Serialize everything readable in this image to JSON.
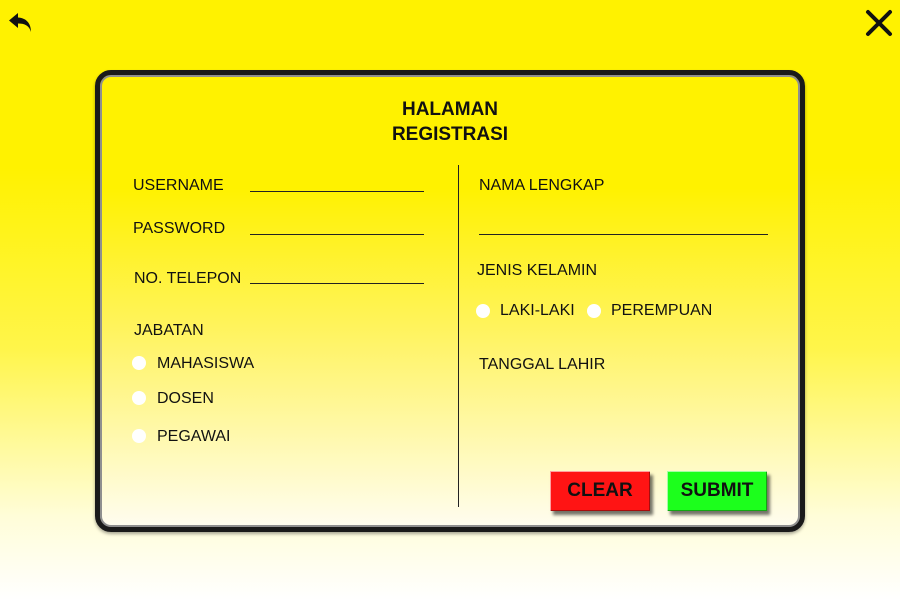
{
  "nav": {
    "back_icon": "undo-arrow-icon",
    "close_icon": "close-x-icon"
  },
  "form": {
    "title_line1": "HALAMAN",
    "title_line2": "REGISTRASI",
    "username_label": "USERNAME",
    "password_label": "PASSWORD",
    "phone_label": "NO. TELEPON",
    "position_label": "JABATAN",
    "position_options": [
      "MAHASISWA",
      "DOSEN",
      "PEGAWAI"
    ],
    "fullname_label": "NAMA LENGKAP",
    "gender_label": "JENIS KELAMIN",
    "gender_options": [
      "LAKI-LAKI",
      "PEREMPUAN"
    ],
    "birthdate_label": "TANGGAL LAHIR",
    "username_value": "",
    "password_value": "",
    "phone_value": "",
    "fullname_value": ""
  },
  "buttons": {
    "clear": "CLEAR",
    "submit": "SUBMIT"
  },
  "colors": {
    "background": "#fff200",
    "clear_button": "#ff1414",
    "submit_button": "#1cff1c",
    "border": "#1a1a1a"
  }
}
